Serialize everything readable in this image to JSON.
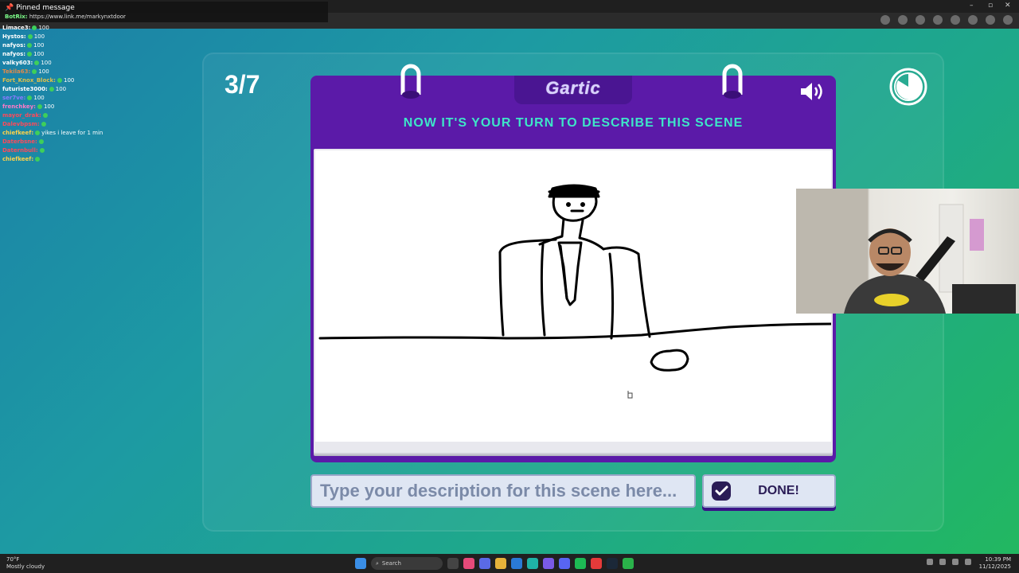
{
  "pinned": {
    "title": "Pinned message",
    "sender": "BotRix:",
    "text": "https://www.link.me/markynxtdoor"
  },
  "chat": [
    {
      "user": "Limace3:",
      "msg": "100",
      "color": "#ffffff"
    },
    {
      "user": "Hystos:",
      "msg": "100",
      "color": "#ffffff"
    },
    {
      "user": "nafyos:",
      "msg": "100",
      "color": "#ffffff"
    },
    {
      "user": "nafyos:",
      "msg": "100",
      "color": "#ffffff"
    },
    {
      "user": "valky603:",
      "msg": "100",
      "color": "#ffffff"
    },
    {
      "user": "Tekila63:",
      "msg": "100",
      "color": "#e08a4a"
    },
    {
      "user": "Fort_Knox_Block:",
      "msg": "100",
      "color": "#e0c04a"
    },
    {
      "user": "futuriste3000:",
      "msg": "100",
      "color": "#ffffff"
    },
    {
      "user": "ser7ve:",
      "msg": "100",
      "color": "#8a7aff"
    },
    {
      "user": "frenchkey:",
      "msg": "100",
      "color": "#ff7ac8"
    },
    {
      "user": "mayor_drak:",
      "msg": "",
      "color": "#ff4a5a"
    },
    {
      "user": "Dalevbpsm:",
      "msg": "",
      "color": "#ff4a5a"
    },
    {
      "user": "chiefkeef:",
      "msg": "yikes i leave for 1 min",
      "color": "#ffd24a"
    },
    {
      "user": "Daterbsne:",
      "msg": "",
      "color": "#ff4a5a"
    },
    {
      "user": "Daternbull:",
      "msg": "",
      "color": "#ff4a5a"
    },
    {
      "user": "chiefkeef:",
      "msg": "",
      "color": "#ffd24a"
    }
  ],
  "game": {
    "round": "3/7",
    "logo": "Gartic",
    "instruction": "NOW IT'S YOUR TURN TO DESCRIBE THIS SCENE",
    "input_placeholder": "Type your description for this scene here...",
    "input_value": "",
    "done_label": "DONE!"
  },
  "taskbar": {
    "weather_temp": "70°F",
    "weather_desc": "Mostly cloudy",
    "search_label": "Search",
    "time": "10:39 PM",
    "date": "11/12/2025"
  },
  "colors": {
    "card_purple": "#5b1aa8",
    "instruction_teal": "#3ee6c8"
  }
}
